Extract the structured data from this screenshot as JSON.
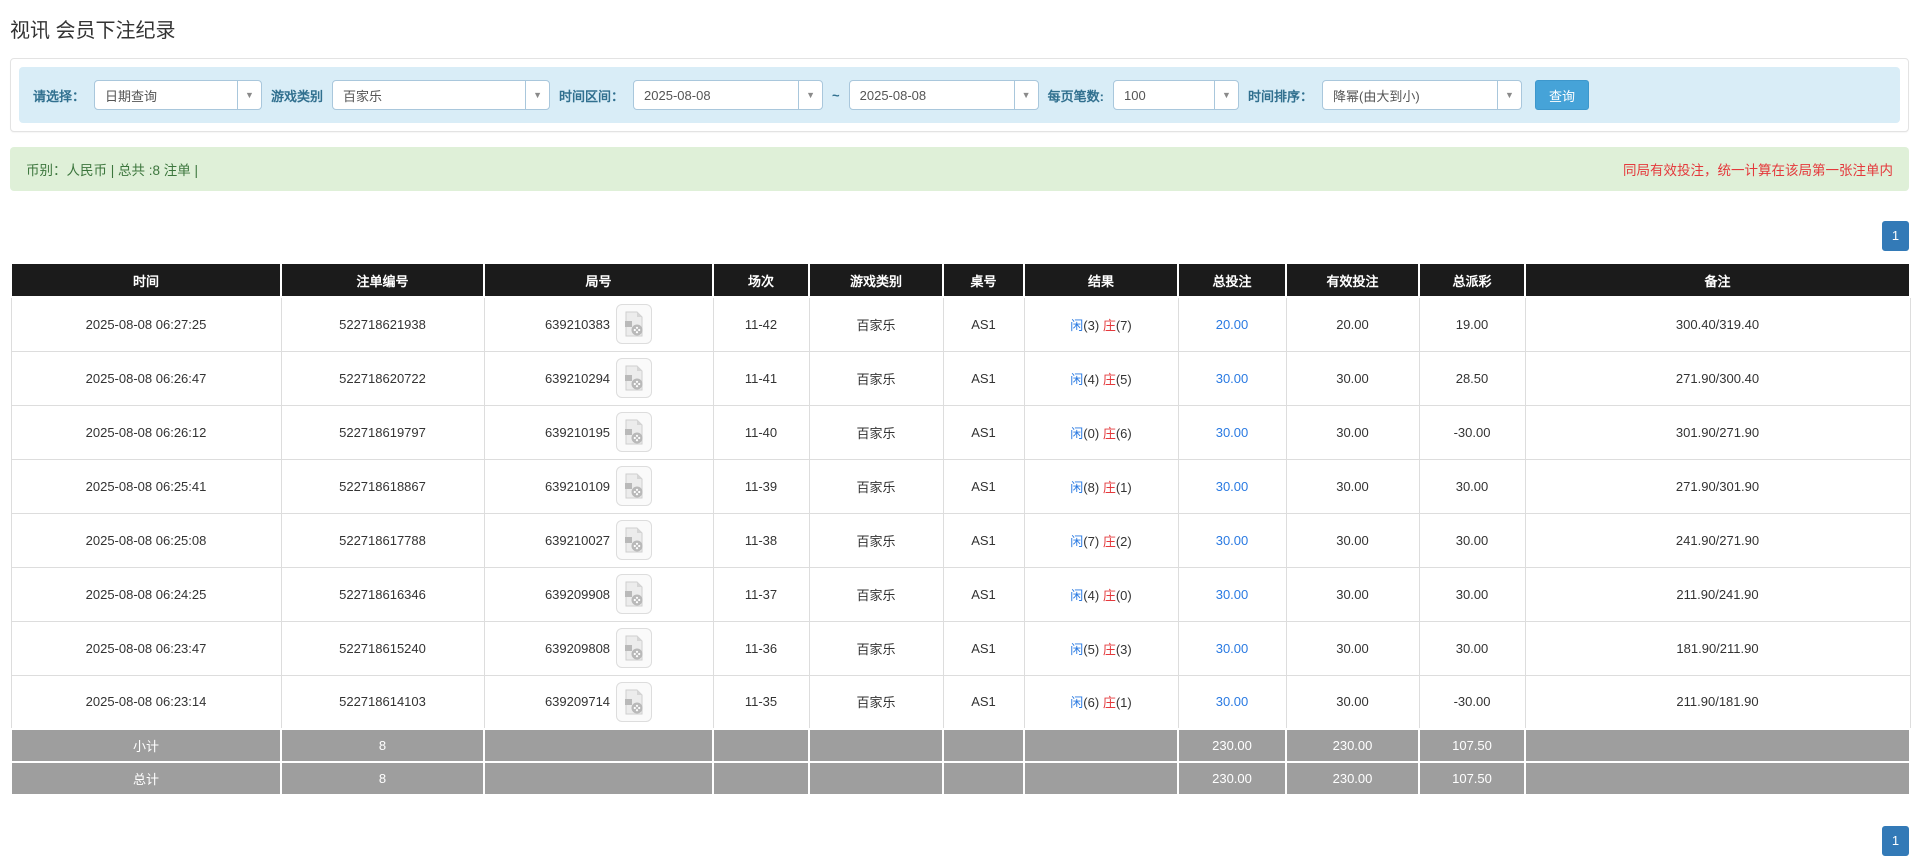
{
  "page": {
    "title": "视讯 会员下注纪录"
  },
  "filters": {
    "select_label": "请选择：",
    "select_value": "日期查询",
    "game_type_label": "游戏类别",
    "game_type_value": "百家乐",
    "date_range_label": "时间区间：",
    "date_from": "2025-08-08",
    "range_separator": "~",
    "date_to": "2025-08-08",
    "page_size_label": "每页笔数:",
    "page_size_value": "100",
    "sort_label": "时间排序：",
    "sort_value": "降幂(由大到小)",
    "search_button": "查询"
  },
  "summary_bar": {
    "left_text": "币别：人民币 | 总共 :8 注单 |",
    "right_text": "同局有效投注，统一计算在该局第一张注单内"
  },
  "pagination": {
    "page": "1"
  },
  "colors": {
    "accent_blue": "#337ab7",
    "link_blue": "#2a7ae2",
    "danger_red": "#e4393c",
    "success_green": "#3c763d",
    "header_black": "#1b1b1b",
    "footer_gray": "#9e9e9e",
    "filter_bar_blue": "#d9edf7",
    "summary_green": "#dff0d8"
  },
  "table": {
    "headers": [
      "时间",
      "注单编号",
      "局号",
      "场次",
      "游戏类别",
      "桌号",
      "结果",
      "总投注",
      "有效投注",
      "总派彩",
      "备注"
    ],
    "rows": [
      {
        "time": "2025-08-08 06:27:25",
        "bet_id": "522718621938",
        "round_id": "639210383",
        "session": "11-42",
        "game": "百家乐",
        "table_no": "AS1",
        "result": {
          "player_label": "闲",
          "player_count": "(3)",
          "banker_label": "庄",
          "banker_count": "(7)"
        },
        "total_bet": "20.00",
        "valid_bet": "20.00",
        "payout": "19.00",
        "payout_negative": false,
        "remark": "300.40/319.40"
      },
      {
        "time": "2025-08-08 06:26:47",
        "bet_id": "522718620722",
        "round_id": "639210294",
        "session": "11-41",
        "game": "百家乐",
        "table_no": "AS1",
        "result": {
          "player_label": "闲",
          "player_count": "(4)",
          "banker_label": "庄",
          "banker_count": "(5)"
        },
        "total_bet": "30.00",
        "valid_bet": "30.00",
        "payout": "28.50",
        "payout_negative": false,
        "remark": "271.90/300.40"
      },
      {
        "time": "2025-08-08 06:26:12",
        "bet_id": "522718619797",
        "round_id": "639210195",
        "session": "11-40",
        "game": "百家乐",
        "table_no": "AS1",
        "result": {
          "player_label": "闲",
          "player_count": "(0)",
          "banker_label": "庄",
          "banker_count": "(6)"
        },
        "total_bet": "30.00",
        "valid_bet": "30.00",
        "payout": "-30.00",
        "payout_negative": true,
        "remark": "301.90/271.90"
      },
      {
        "time": "2025-08-08 06:25:41",
        "bet_id": "522718618867",
        "round_id": "639210109",
        "session": "11-39",
        "game": "百家乐",
        "table_no": "AS1",
        "result": {
          "player_label": "闲",
          "player_count": "(8)",
          "banker_label": "庄",
          "banker_count": "(1)"
        },
        "total_bet": "30.00",
        "valid_bet": "30.00",
        "payout": "30.00",
        "payout_negative": false,
        "remark": "271.90/301.90"
      },
      {
        "time": "2025-08-08 06:25:08",
        "bet_id": "522718617788",
        "round_id": "639210027",
        "session": "11-38",
        "game": "百家乐",
        "table_no": "AS1",
        "result": {
          "player_label": "闲",
          "player_count": "(7)",
          "banker_label": "庄",
          "banker_count": "(2)"
        },
        "total_bet": "30.00",
        "valid_bet": "30.00",
        "payout": "30.00",
        "payout_negative": false,
        "remark": "241.90/271.90"
      },
      {
        "time": "2025-08-08 06:24:25",
        "bet_id": "522718616346",
        "round_id": "639209908",
        "session": "11-37",
        "game": "百家乐",
        "table_no": "AS1",
        "result": {
          "player_label": "闲",
          "player_count": "(4)",
          "banker_label": "庄",
          "banker_count": "(0)"
        },
        "total_bet": "30.00",
        "valid_bet": "30.00",
        "payout": "30.00",
        "payout_negative": false,
        "remark": "211.90/241.90"
      },
      {
        "time": "2025-08-08 06:23:47",
        "bet_id": "522718615240",
        "round_id": "639209808",
        "session": "11-36",
        "game": "百家乐",
        "table_no": "AS1",
        "result": {
          "player_label": "闲",
          "player_count": "(5)",
          "banker_label": "庄",
          "banker_count": "(3)"
        },
        "total_bet": "30.00",
        "valid_bet": "30.00",
        "payout": "30.00",
        "payout_negative": false,
        "remark": "181.90/211.90"
      },
      {
        "time": "2025-08-08 06:23:14",
        "bet_id": "522718614103",
        "round_id": "639209714",
        "session": "11-35",
        "game": "百家乐",
        "table_no": "AS1",
        "result": {
          "player_label": "闲",
          "player_count": "(6)",
          "banker_label": "庄",
          "banker_count": "(1)"
        },
        "total_bet": "30.00",
        "valid_bet": "30.00",
        "payout": "-30.00",
        "payout_negative": true,
        "remark": "211.90/181.90"
      }
    ],
    "footer_rows": [
      {
        "label": "小计",
        "count": "8",
        "total_bet": "230.00",
        "valid_bet": "230.00",
        "payout": "107.50"
      },
      {
        "label": "总计",
        "count": "8",
        "total_bet": "230.00",
        "valid_bet": "230.00",
        "payout": "107.50"
      }
    ]
  }
}
